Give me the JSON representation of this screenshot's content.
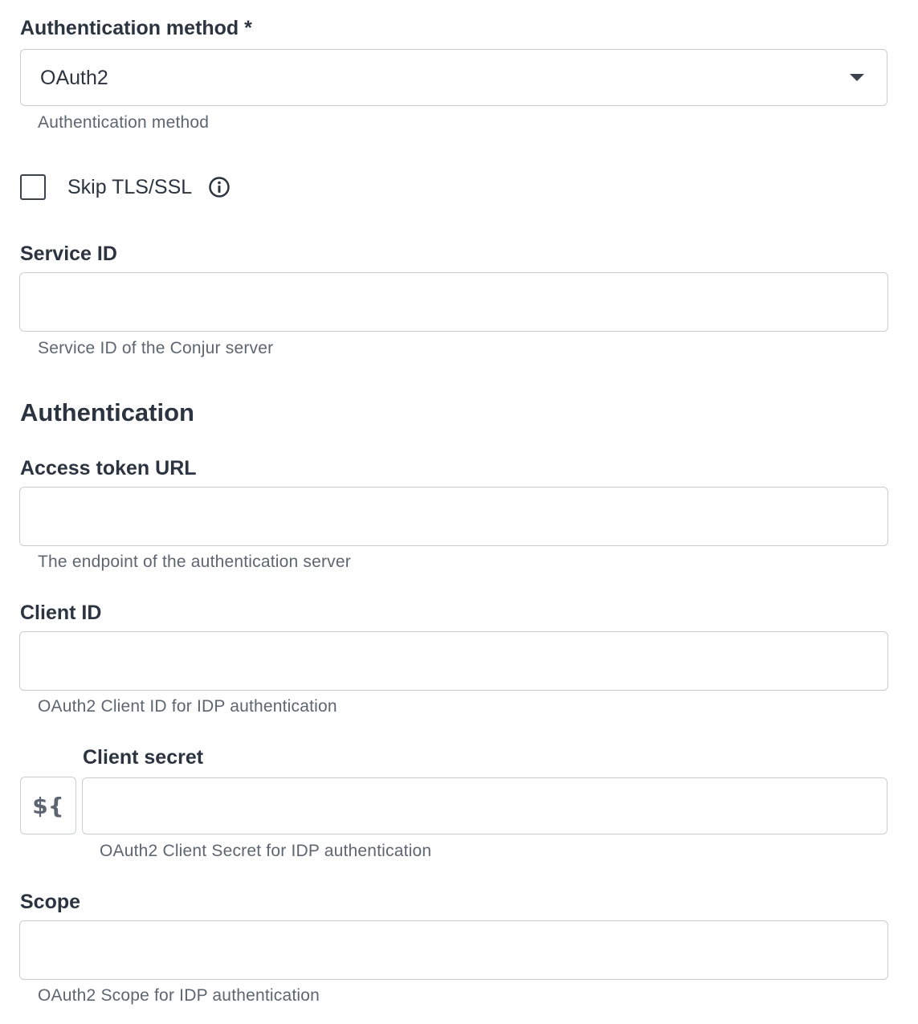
{
  "auth_method": {
    "label": "Authentication method *",
    "value": "OAuth2",
    "helper": "Authentication method"
  },
  "skip_tls": {
    "label": "Skip TLS/SSL",
    "checked": false,
    "icon": "info-icon"
  },
  "service_id": {
    "label": "Service ID",
    "value": "",
    "helper": "Service ID of the Conjur server"
  },
  "authentication_section": {
    "title": "Authentication"
  },
  "access_token_url": {
    "label": "Access token URL",
    "value": "",
    "helper": "The endpoint of the authentication server"
  },
  "client_id": {
    "label": "Client ID",
    "value": "",
    "helper": "OAuth2 Client ID for IDP authentication"
  },
  "client_secret": {
    "label": "Client secret",
    "variable_button": "${",
    "value": "",
    "helper": "OAuth2 Client Secret for IDP authentication"
  },
  "scope": {
    "label": "Scope",
    "value": "",
    "helper": "OAuth2 Scope for IDP authentication"
  }
}
